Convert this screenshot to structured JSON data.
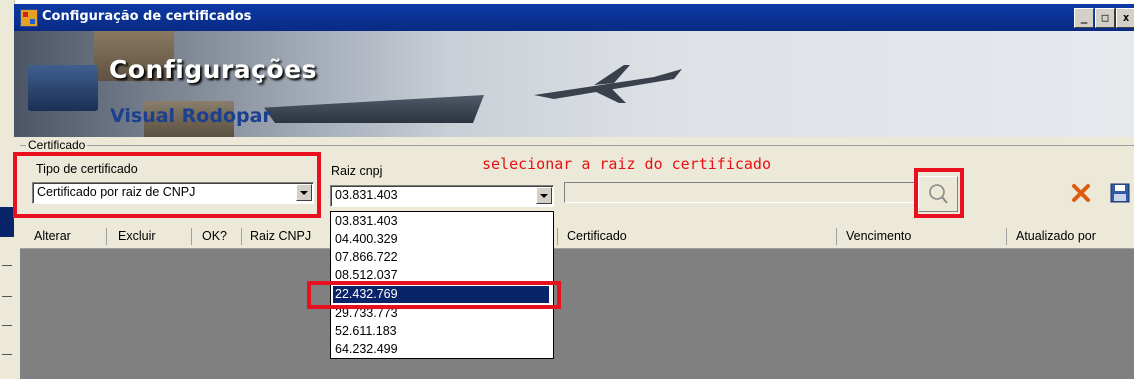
{
  "window": {
    "title": "Configuração de certificados",
    "controls": {
      "minimize": "_",
      "maximize": "□",
      "close": "x"
    }
  },
  "banner": {
    "title": "Configurações",
    "subtitle": "Visual Rodopar"
  },
  "certificate_group": {
    "legend": "Certificado",
    "type_label": "Tipo de certificado",
    "type_value": "Certificado por raiz de CNPJ",
    "root_label": "Raiz cnpj",
    "root_value": "03.831.403",
    "certificate_field_value": "",
    "annotation": "selecionar a raiz do certificado",
    "search_icon": "magnifier-icon",
    "cancel_icon": "x-icon",
    "save_icon": "floppy-disk-icon"
  },
  "grid": {
    "columns": [
      "Alterar",
      "Excluir",
      "OK?",
      "Raiz CNPJ",
      "Certificado",
      "Vencimento",
      "Atualizado por"
    ]
  },
  "dropdown": {
    "options": [
      "03.831.403",
      "04.400.329",
      "07.866.722",
      "08.512.037",
      "22.432.769",
      "29.733.773",
      "52.611.183",
      "64.232.499"
    ],
    "selected": "22.432.769"
  },
  "colors": {
    "titlebar": "#0a2a83",
    "highlight": "#e8101e",
    "selection": "#0a246a",
    "grid_background": "#808080"
  }
}
